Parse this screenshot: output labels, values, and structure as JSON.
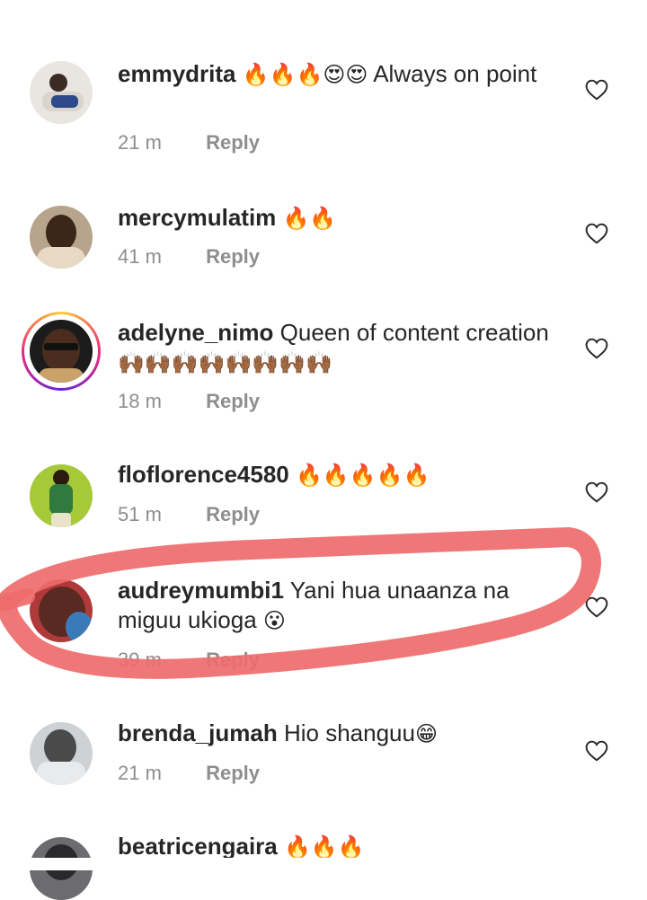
{
  "comments": [
    {
      "username": "emmydrita",
      "text": "Always on point",
      "emojis": "🔥🔥🔥😍😍",
      "time": "21 m",
      "reply": "Reply"
    },
    {
      "username": "mercymulatim",
      "text": "",
      "emojis": "🔥🔥",
      "time": "41 m",
      "reply": "Reply"
    },
    {
      "username": "adelyne_nimo",
      "text": "Queen of content creation",
      "emojis": "🙌🏾🙌🏾🙌🏾🙌🏾🙌🏾🙌🏾🙌🏾🙌🏾",
      "time": "18 m",
      "reply": "Reply"
    },
    {
      "username": "floflorence4580",
      "text": "",
      "emojis": "🔥🔥🔥🔥🔥",
      "time": "51 m",
      "reply": "Reply"
    },
    {
      "username": "audreymumbi1",
      "text": "Yani hua unaanza na miguu ukioga",
      "emojis": "😮",
      "time": "39 m",
      "reply": "Reply"
    },
    {
      "username": "brenda_jumah",
      "text": "Hio shanguu",
      "emojis": "😁",
      "time": "21 m",
      "reply": "Reply"
    },
    {
      "username": "beatricengaira",
      "text": "",
      "emojis": "🔥🔥🔥",
      "time": "",
      "reply": ""
    }
  ],
  "colors": {
    "highlight": "#ee6b6b",
    "meta": "#8e8e8e",
    "text": "#262626"
  },
  "icons": {
    "like": "heart-outline-icon"
  }
}
